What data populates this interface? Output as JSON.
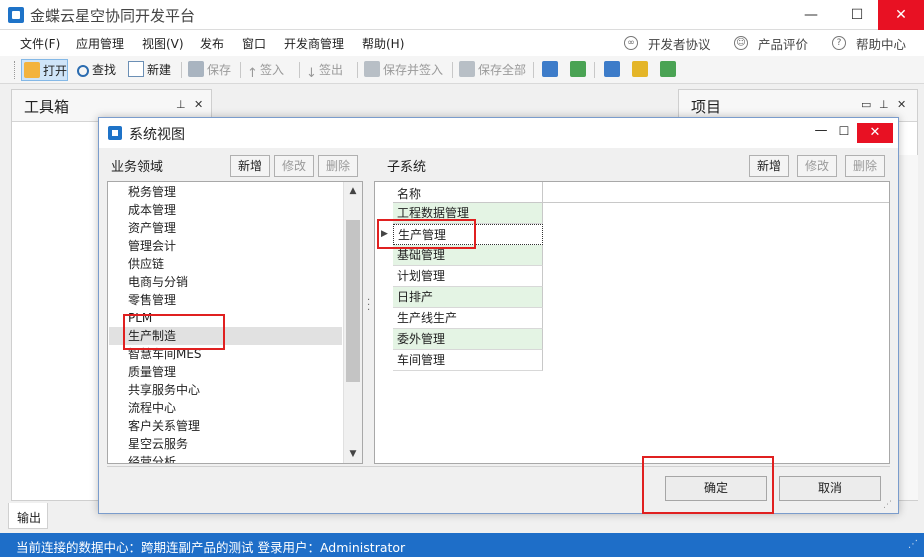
{
  "app": {
    "title": "金蝶云星空协同开发平台",
    "win_min": "—",
    "win_max": "☐",
    "win_close": "✕"
  },
  "menu": {
    "items": [
      "文件(F)",
      "应用管理",
      "视图(V)",
      "发布",
      "窗口",
      "开发商管理",
      "帮助(H)"
    ],
    "right": [
      "开发者协议",
      "产品评价",
      "帮助中心"
    ]
  },
  "toolbar": {
    "open": "打开",
    "find": "查找",
    "new": "新建",
    "save": "保存",
    "checkin": "签入",
    "checkout": "签出",
    "save_checkin": "保存并签入",
    "save_all": "保存全部"
  },
  "panels": {
    "toolbox_title": "工具箱",
    "project_title": "项目",
    "output_label": "输出"
  },
  "status": {
    "text": "当前连接的数据中心：跨期连副产品的测试   登录用户：Administrator"
  },
  "dialog": {
    "title": "系统视图",
    "left_label": "业务领域",
    "right_label": "子系统",
    "btn_add": "新增",
    "btn_edit": "修改",
    "btn_delete": "删除",
    "domains": [
      "税务管理",
      "成本管理",
      "资产管理",
      "管理会计",
      "供应链",
      "电商与分销",
      "零售管理",
      "PLM",
      "生产制造",
      "智慧车间MES",
      "质量管理",
      "共享服务中心",
      "流程中心",
      "客户关系管理",
      "星空云服务",
      "经营分析"
    ],
    "selected_domain": "生产制造",
    "grid_header": "名称",
    "subsystems": [
      "工程数据管理",
      "生产管理",
      "基础管理",
      "计划管理",
      "日排产",
      "生产线生产",
      "委外管理",
      "车间管理"
    ],
    "selected_subsystem": "生产管理",
    "ok": "确定",
    "cancel": "取消"
  },
  "colors": {
    "status_bar": "#1e6ec8",
    "highlight": "#e02020",
    "grid_alt_row": "#e4f4e4",
    "close_red": "#e81123"
  }
}
